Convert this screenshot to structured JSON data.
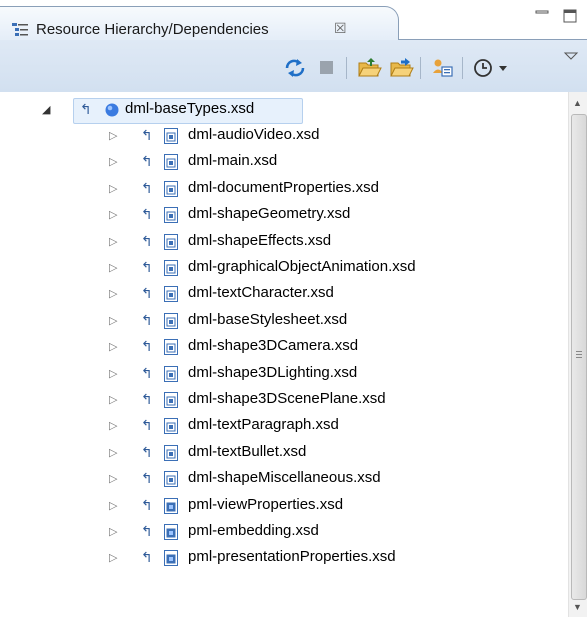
{
  "tab": {
    "title": "Resource Hierarchy/Dependencies",
    "close_glyph": "☒"
  },
  "toolbar": {
    "buttons": [
      "refresh-icon",
      "stop-icon",
      "folder-open-icon",
      "folder-export-icon",
      "hierarchy-icon",
      "history-icon",
      "view-menu-icon"
    ]
  },
  "tree": {
    "root": "dml-baseTypes.xsd",
    "children": [
      "dml-audioVideo.xsd",
      "dml-main.xsd",
      "dml-documentProperties.xsd",
      "dml-shapeGeometry.xsd",
      "dml-shapeEffects.xsd",
      "dml-graphicalObjectAnimation.xsd",
      "dml-textCharacter.xsd",
      "dml-baseStylesheet.xsd",
      "dml-shape3DCamera.xsd",
      "dml-shape3DLighting.xsd",
      "dml-shape3DScenePlane.xsd",
      "dml-textParagraph.xsd",
      "dml-textBullet.xsd",
      "dml-shapeMiscellaneous.xsd",
      "pml-viewProperties.xsd",
      "pml-embedding.xsd",
      "pml-presentationProperties.xsd"
    ]
  },
  "colors": {
    "selection": "#e7f1fc",
    "toolbar": "#d8e4f2",
    "border": "#8a9fb8"
  }
}
